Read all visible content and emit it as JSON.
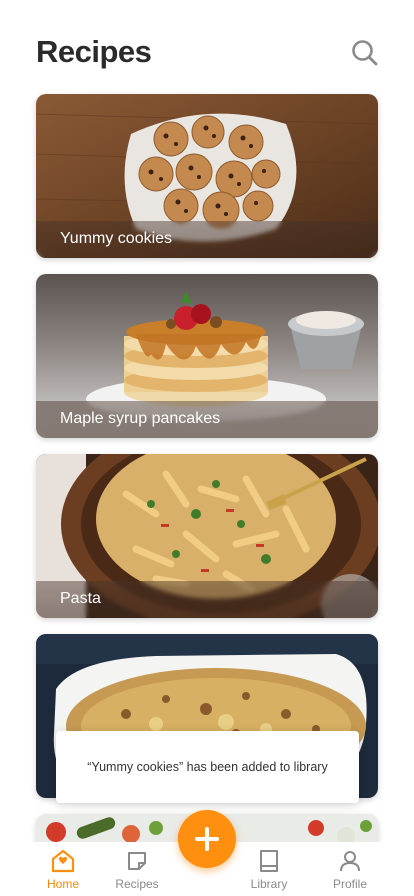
{
  "header": {
    "title": "Recipes",
    "search_icon": "search-icon"
  },
  "recipes": [
    {
      "name": "Yummy cookies"
    },
    {
      "name": "Maple syrup pancakes"
    },
    {
      "name": "Pasta"
    },
    {
      "name": ""
    },
    {
      "name": ""
    }
  ],
  "toast": {
    "message": "“Yummy cookies” has been added to library"
  },
  "tabbar": {
    "items": [
      {
        "label": "Home",
        "icon": "home-icon",
        "active": true
      },
      {
        "label": "Recipes",
        "icon": "recipes-icon",
        "active": false
      },
      {
        "label": "Library",
        "icon": "library-icon",
        "active": false
      },
      {
        "label": "Profile",
        "icon": "profile-icon",
        "active": false
      }
    ],
    "fab_icon": "plus-icon"
  },
  "colors": {
    "accent": "#ff8f0f",
    "inactive": "#8a8a8a",
    "title": "#2b2b2b"
  }
}
